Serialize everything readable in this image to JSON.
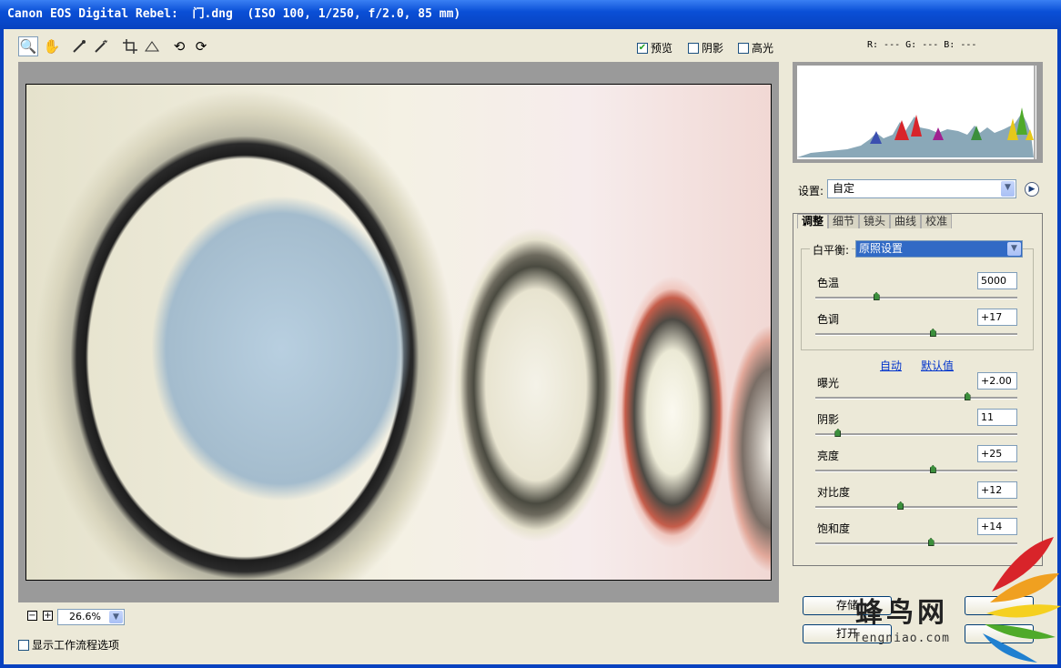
{
  "window": {
    "title": "Canon EOS Digital Rebel:  门.dng  (ISO 100, 1/250, f/2.0, 85 mm)"
  },
  "toolbar": {
    "tools": [
      "zoom-icon",
      "hand-icon",
      "white-balance-icon",
      "color-sampler-icon",
      "crop-icon",
      "straighten-icon",
      "rotate-left-icon",
      "rotate-right-icon"
    ],
    "preview_label": "预览",
    "preview_checked": true,
    "shadows_label": "阴影",
    "highlights_label": "高光"
  },
  "rgb_readout": "R: ---  G: ---  B: ---",
  "zoom": {
    "minus": "−",
    "plus": "+",
    "value": "26.6%"
  },
  "workflow_option": "显示工作流程选项",
  "settings": {
    "label": "设置:",
    "value": "自定"
  },
  "tabs": [
    "调整",
    "细节",
    "镜头",
    "曲线",
    "校准"
  ],
  "white_balance": {
    "label": "白平衡:",
    "value": "原照设置"
  },
  "sliders_wb": [
    {
      "label": "色温",
      "value": "5000",
      "position": 0.3
    },
    {
      "label": "色调",
      "value": "+17",
      "position": 0.58
    }
  ],
  "links": {
    "auto": "自动",
    "default": "默认值"
  },
  "sliders_tone": [
    {
      "label": "曝光",
      "value": "+2.00",
      "position": 0.75
    },
    {
      "label": "阴影",
      "value": "11",
      "position": 0.11
    },
    {
      "label": "亮度",
      "value": "+25",
      "position": 0.58
    },
    {
      "label": "对比度",
      "value": "+12",
      "position": 0.42
    },
    {
      "label": "饱和度",
      "value": "+14",
      "position": 0.57
    }
  ],
  "buttons": {
    "save": "存储",
    "open": "打开"
  },
  "watermark": {
    "text": "蜂鸟网",
    "sub": "fengniao.com"
  }
}
